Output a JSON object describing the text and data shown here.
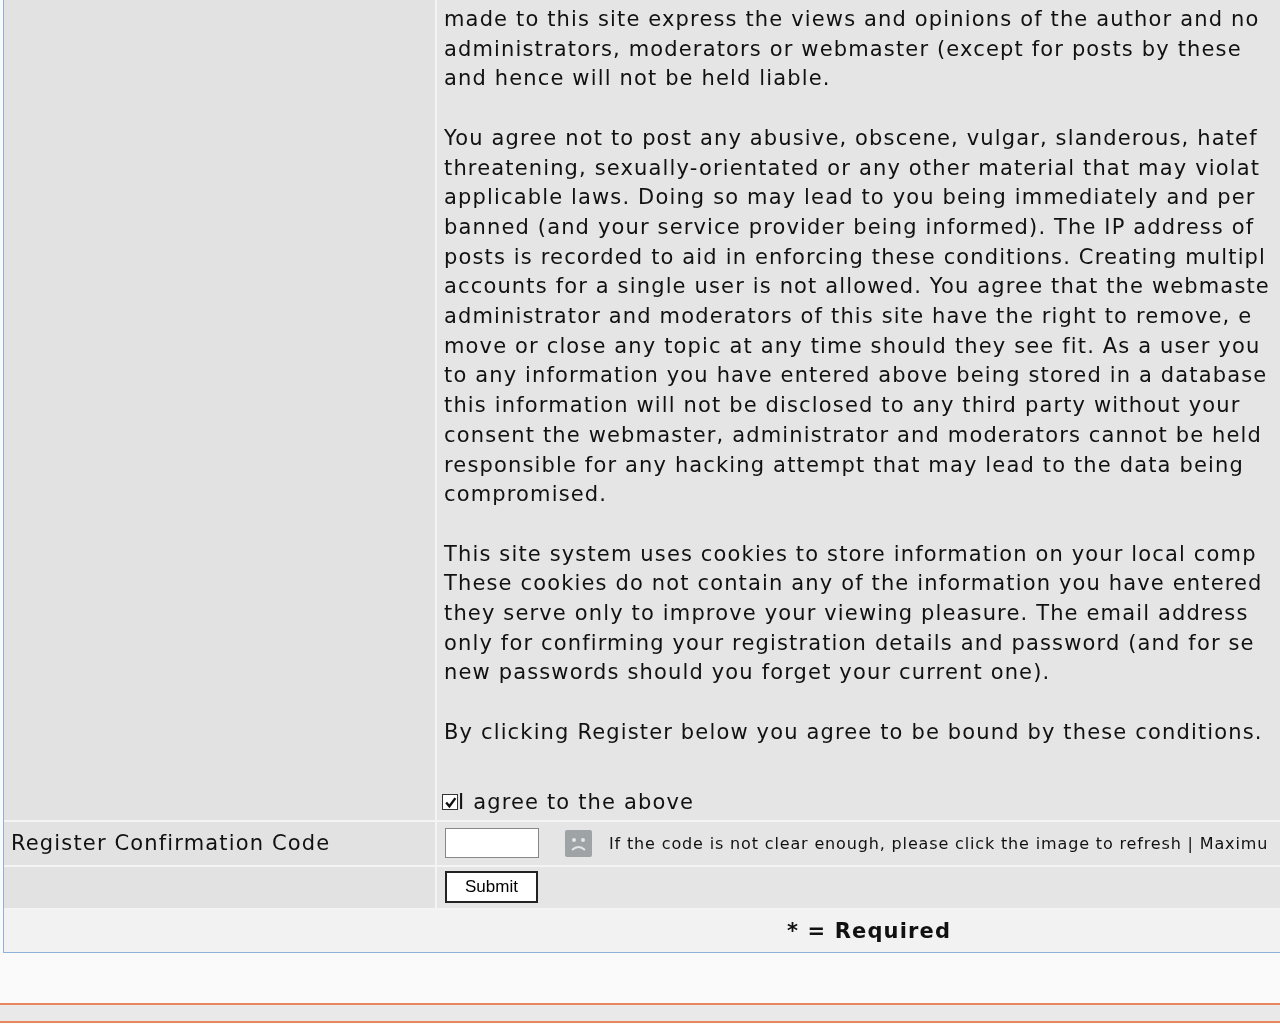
{
  "terms": {
    "paragraphs": [
      [
        "made to this site express the views and opinions of the author and no",
        "administrators, moderators or webmaster (except for posts by these",
        "and hence will not be held liable."
      ],
      [
        "You agree not to post any abusive, obscene, vulgar, slanderous, hatef",
        "threatening, sexually-orientated or any other material that may violat",
        "applicable laws. Doing so may lead to you being immediately and per",
        "banned (and your service provider being informed). The IP address of",
        "posts is recorded to aid in enforcing these conditions. Creating multipl",
        "accounts for a single user is not allowed. You agree that the webmaste",
        "administrator and moderators of this site have the right to remove, e",
        "move or close any topic at any time should they see fit. As a user you",
        "to any information you have entered above being stored in a database",
        "this information will not be disclosed to any third party without your",
        "consent the webmaster, administrator and moderators cannot be held",
        "responsible for any hacking attempt that may lead to the data being",
        "compromised."
      ],
      [
        "This site system uses cookies to store information on your local comp",
        "These cookies do not contain any of the information you have entered",
        "they serve only to improve your viewing pleasure. The email address",
        "only for confirming your registration details and password (and for se",
        "new passwords should you forget your current one)."
      ],
      [
        "By clicking Register below you agree to be bound by these conditions."
      ]
    ]
  },
  "agree": {
    "label": "I agree to the above",
    "checked": true
  },
  "confirmation": {
    "label": "Register Confirmation Code",
    "hint": "If the code is not clear enough, please click the image to refresh | Maximu"
  },
  "submit": {
    "label": "Submit"
  },
  "footer": {
    "required_note": "* = Required"
  }
}
